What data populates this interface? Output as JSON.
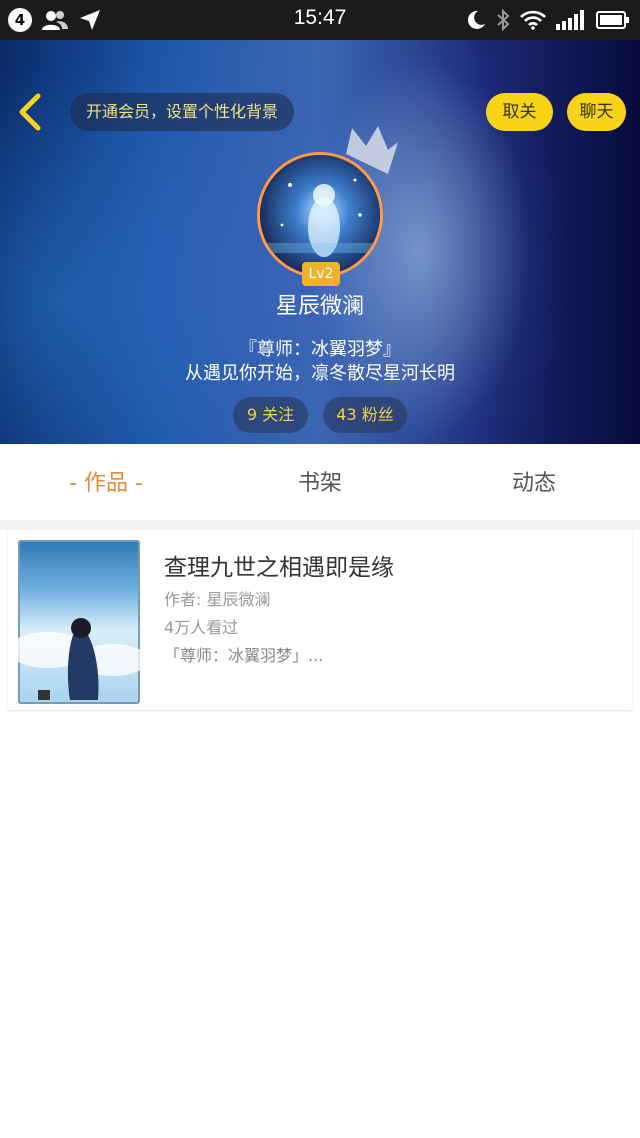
{
  "status_bar": {
    "notification_count": "4",
    "time": "15:47"
  },
  "header": {
    "vip_banner": "开通会员，设置个性化背景",
    "unfollow_label": "取关",
    "chat_label": "聊天",
    "level": "Lv2",
    "nickname": "星辰微澜",
    "bio_line1": "『尊师：冰翼羽梦』",
    "bio_line2": "从遇见你开始，凛冬散尽星河长明",
    "following": "9 关注",
    "followers": "43 粉丝"
  },
  "tabs": {
    "works": "- 作品 -",
    "shelf": "书架",
    "feed": "动态"
  },
  "books": [
    {
      "title": "查理九世之相遇即是缘",
      "author": "作者: 星辰微澜",
      "views": "4万人看过",
      "desc": "「尊师：冰翼羽梦」..."
    }
  ],
  "colors": {
    "accent_yellow": "#f7d418",
    "tab_active": "#f0883a",
    "level_badge": "#f2b12a"
  }
}
